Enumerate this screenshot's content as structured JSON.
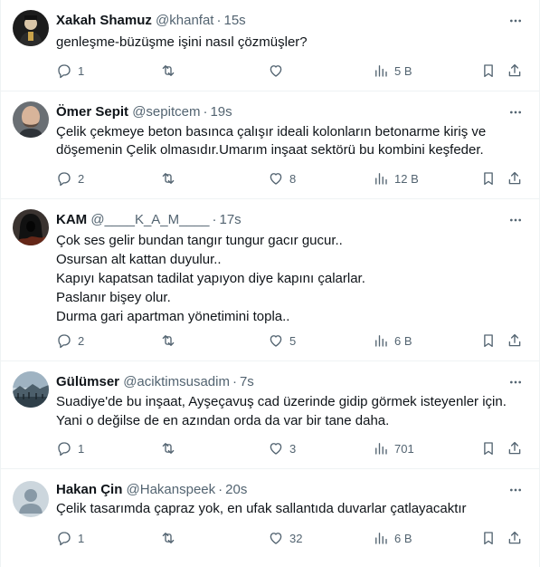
{
  "tweets": [
    {
      "name": "Xakah Shamuz",
      "handle": "@khanfat",
      "time": "15s",
      "lines": [
        "genleşme-büzüşme işini nasıl çözmüşler?"
      ],
      "replies": "1",
      "retweets": "",
      "likes": "",
      "views": "5 B",
      "avatar": "dark-figure-avatar"
    },
    {
      "name": "Ömer Sepit",
      "handle": "@sepitcem",
      "time": "19s",
      "lines": [
        "Çelik çekmeye beton basınca çalışır ideali kolonların betonarme kiriş ve",
        "döşemenin Çelik olmasıdır.Umarım inşaat sektörü bu kombini keşfeder."
      ],
      "replies": "2",
      "retweets": "",
      "likes": "8",
      "views": "12 B",
      "avatar": "bald-man-avatar"
    },
    {
      "name": "KAM",
      "handle": "@____K_A_M____",
      "time": "17s",
      "lines": [
        "Çok ses gelir bundan tangır tungur gacır gucur..",
        "Osursan alt kattan duyulur..",
        "Kapıyı kapatsan tadilat yapıyon diye kapını çalarlar.",
        "Paslanır bişey olur.",
        "Durma gari apartman yönetimini topla.."
      ],
      "replies": "2",
      "retweets": "",
      "likes": "5",
      "views": "6 B",
      "avatar": "hooded-figure-avatar"
    },
    {
      "name": "Gülümser",
      "handle": "@aciktimsusadim",
      "time": "7s",
      "lines": [
        "Suadiye'de bu inşaat, Ayşeçavuş cad üzerinde gidip görmek isteyenler için.",
        "Yani o değilse de en azından orda da var bir tane daha."
      ],
      "replies": "1",
      "retweets": "",
      "likes": "3",
      "views": "701",
      "avatar": "landscape-avatar"
    },
    {
      "name": "Hakan Çin",
      "handle": "@Hakanspeek",
      "time": "20s",
      "lines": [
        "Çelik tasarımda çapraz yok, en ufak sallantıda duvarlar çatlayacaktır"
      ],
      "replies": "1",
      "retweets": "",
      "likes": "32",
      "views": "6 B",
      "avatar": "default-user-avatar"
    }
  ],
  "colors": {
    "text": "#0f1419",
    "secondary": "#536471",
    "divider": "#eff3f4",
    "background": "#ffffff"
  },
  "icons": {
    "reply": "reply-icon",
    "retweet": "retweet-icon",
    "like": "like-icon",
    "views": "views-icon",
    "bookmark": "bookmark-icon",
    "share": "share-icon",
    "more": "more-icon"
  }
}
